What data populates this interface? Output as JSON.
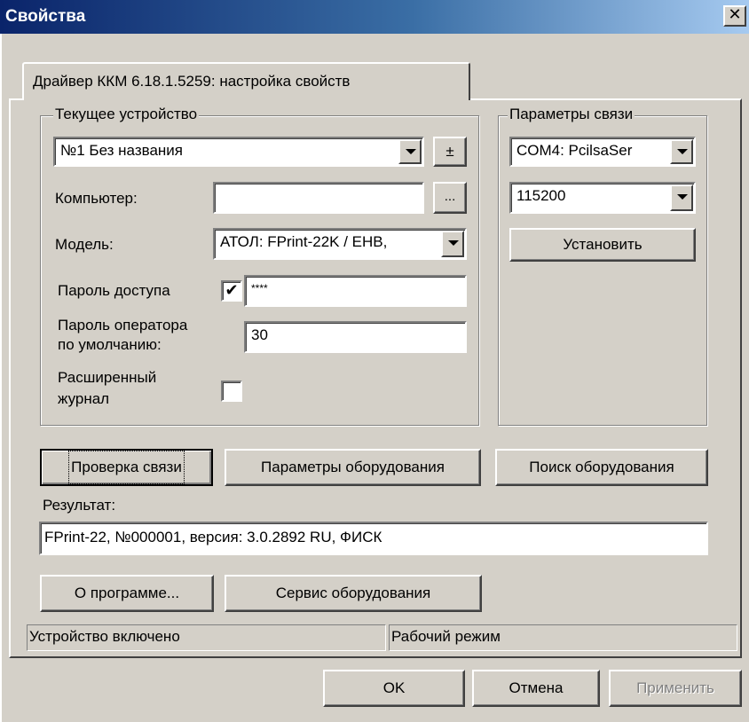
{
  "window": {
    "title": "Свойства",
    "close_symbol": "✕"
  },
  "tab": {
    "label": "Драйвер ККМ 6.18.1.5259: настройка свойств"
  },
  "current_device": {
    "group_label": "Текущее устройство",
    "device_value": "№1 Без названия",
    "plus_minus": "±",
    "computer_label": "Компьютер:",
    "computer_value": "",
    "browse_label": "...",
    "model_label": "Модель:",
    "model_value": "АТОЛ: FPrint-22K / ЕНВ,",
    "password_label": "Пароль доступа",
    "password_checked": "✔",
    "password_value": "****",
    "operator_password_label_1": "Пароль оператора",
    "operator_password_label_2": "по умолчанию:",
    "operator_password_value": "30",
    "extended_log_label_1": "Расширенный",
    "extended_log_label_2": "журнал",
    "extended_log_checked": ""
  },
  "connection": {
    "group_label": "Параметры связи",
    "port_value": "COM4: PcilsaSer",
    "baud_value": "115200",
    "set_button": "Установить"
  },
  "buttons": {
    "check_connection": "Проверка связи",
    "equipment_params": "Параметры оборудования",
    "search_equipment": "Поиск оборудования",
    "about": "О программе...",
    "equipment_service": "Сервис оборудования",
    "ok": "OK",
    "cancel": "Отмена",
    "apply": "Применить"
  },
  "result": {
    "label": "Результат:",
    "value": "FPrint-22, №000001, версия: 3.0.2892 RU, ФИСК"
  },
  "status": {
    "device_state": "Устройство включено",
    "mode": "Рабочий режим"
  },
  "colors": {
    "titlebar_start": "#0a246a",
    "titlebar_end": "#a6caf0",
    "face": "#d4d0c8"
  }
}
